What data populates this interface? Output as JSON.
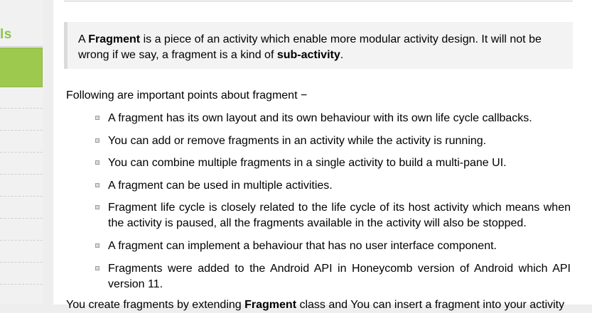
{
  "sidebar": {
    "brand_fragment": "ls",
    "items_count_label": ""
  },
  "note": {
    "prefix": "A ",
    "term": "Fragment",
    "middle": " is a piece of an activity which enable more modular activity design. It will not be wrong if we say, a fragment is a kind of ",
    "term2": "sub-activity",
    "suffix": "."
  },
  "intro": "Following are important points about fragment −",
  "points": [
    "A fragment has its own layout and its own behaviour with its own life cycle callbacks.",
    "You can add or remove fragments in an activity while the activity is running.",
    "You can combine multiple fragments in a single activity to build a multi-pane UI.",
    "A fragment can be used in multiple activities.",
    "Fragment life cycle is closely related to the life cycle of its host activity which means when the activity is paused, all the fragments available in the activity will also be stopped.",
    "A fragment can implement a behaviour that has no user interface component.",
    "Fragments were added to the Android API in Honeycomb version of Android which API version 11."
  ],
  "tail": {
    "prefix": "You create fragments by extending ",
    "term": "Fragment",
    "suffix": " class and You can insert a fragment into your activity"
  },
  "colors": {
    "accent": "#9dc94f",
    "brand_text": "#8bc34a",
    "note_bg": "#f3f3f3"
  }
}
